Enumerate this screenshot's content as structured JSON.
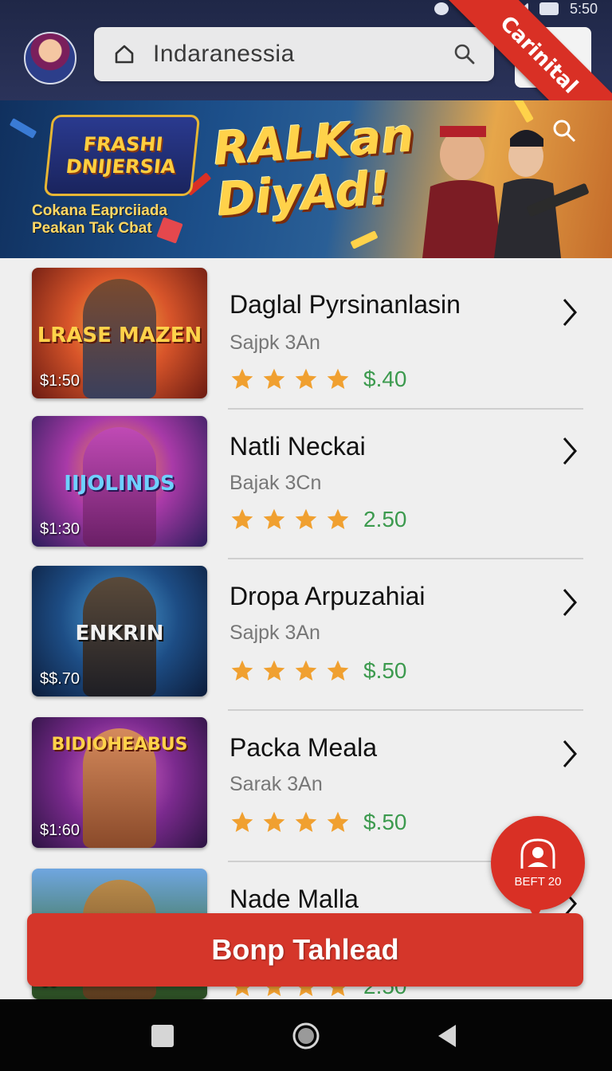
{
  "status_bar": {
    "time": "5:50",
    "icons": [
      "settings-icon",
      "alarm-icon",
      "wifi-icon",
      "signal-icon",
      "battery-icon"
    ]
  },
  "header": {
    "search": {
      "value": "Indaranessia",
      "icons": [
        "home-icon",
        "search-icon"
      ]
    },
    "ribbon_label": "Carinital"
  },
  "banner": {
    "logo_text": "FRASHI DNIJERSIA",
    "subtitle_line1": "Cokana Eaprciiada",
    "subtitle_line2": "Peakan Tak Cbat",
    "headline_line1": "RALKan",
    "headline_line2": "DiyAd!"
  },
  "items": [
    {
      "thumb_title": "LRASE MAZEN",
      "thumb_price": "$1:50",
      "name": "Daglal Pyrsinanlasin",
      "seller": "Sajpk 3An",
      "rating": 4,
      "price": "$.40"
    },
    {
      "thumb_title": "IIJOLINDS",
      "thumb_price": "$1:30",
      "name": "Natli Neckai",
      "seller": "Bajak 3Cn",
      "rating": 4,
      "price": "2.50"
    },
    {
      "thumb_title": "ENKRIN",
      "thumb_price": "$$.70",
      "name": "Dropa Arpuzahiai",
      "seller": "Sajpk 3An",
      "rating": 4,
      "price": "$.50"
    },
    {
      "thumb_title": "BIDIOHEABUS",
      "thumb_price": "$1:60",
      "name": "Packa Meala",
      "seller": "Sarak 3An",
      "rating": 4,
      "price": "$.50"
    },
    {
      "thumb_title": "",
      "thumb_price": "69",
      "name": "Nade Malla",
      "seller": "",
      "rating": 4,
      "price": "2.50"
    }
  ],
  "fab": {
    "label": "BEFT 20"
  },
  "cta": {
    "label": "Bonp Tahlead"
  },
  "colors": {
    "accent": "#d93025",
    "price_green": "#3c9a4e",
    "star": "#f0a030",
    "topbar": "#1f2747"
  }
}
